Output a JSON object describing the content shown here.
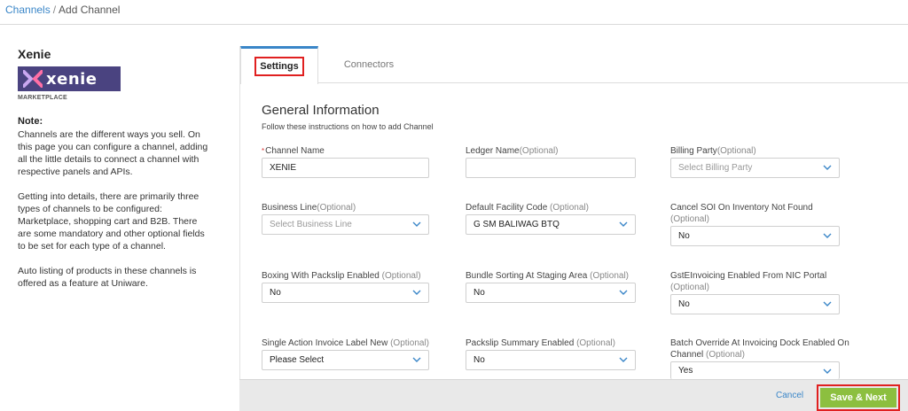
{
  "breadcrumb": {
    "link": "Channels",
    "separator": "/",
    "current": "Add Channel"
  },
  "channel": {
    "name": "Xenie",
    "logo_text": "xenie",
    "type": "MARKETPLACE",
    "note_title": "Note:",
    "note_p1": "Channels are the different ways you sell. On this page you can configure a channel, adding all the little details to connect a channel with respective panels and APIs.",
    "note_p2": "Getting into details, there are primarily three types of channels to be configured: Marketplace, shopping cart and B2B. There are some mandatory and other optional fields to be set for each type of a channel.",
    "note_p3": "Auto listing of products in these channels is offered as a feature at Uniware."
  },
  "tabs": {
    "settings": "Settings",
    "connectors": "Connectors"
  },
  "section": {
    "title": "General Information",
    "subtitle": "Follow these instructions on how to add Channel"
  },
  "fields": {
    "channel_name": {
      "required": "*",
      "label": "Channel Name",
      "value": "XENIE"
    },
    "ledger_name": {
      "label": "Ledger Name",
      "optional": "(Optional)",
      "value": ""
    },
    "billing_party": {
      "label": "Billing Party",
      "optional": "(Optional)",
      "placeholder": "Select Billing Party"
    },
    "business_line": {
      "label": "Business Line",
      "optional": "(Optional)",
      "placeholder": "Select Business Line"
    },
    "default_facility": {
      "label": "Default Facility Code ",
      "optional": "(Optional)",
      "value": "G SM BALIWAG BTQ"
    },
    "cancel_soi": {
      "label": "Cancel SOI On Inventory Not Found",
      "optional": "(Optional)",
      "value": "No"
    },
    "boxing_packslip": {
      "label": "Boxing With Packslip Enabled ",
      "optional": "(Optional)",
      "value": "No"
    },
    "bundle_sorting": {
      "label": "Bundle Sorting At Staging Area ",
      "optional": "(Optional)",
      "value": "No"
    },
    "gst_einvoicing": {
      "label": "GstEInvoicing Enabled From NIC Portal",
      "optional": "(Optional)",
      "value": "No"
    },
    "single_action_invoice": {
      "label": "Single Action Invoice Label New ",
      "optional": "(Optional)",
      "value": "Please Select"
    },
    "packslip_summary": {
      "label": "Packslip Summary Enabled ",
      "optional": "(Optional)",
      "value": "No"
    },
    "batch_override": {
      "label": "Batch Override At Invoicing Dock Enabled On Channel ",
      "optional": "(Optional)",
      "value": "Yes"
    }
  },
  "footer": {
    "cancel": "Cancel",
    "save": "Save & Next"
  },
  "colors": {
    "accent": "#3a86c8",
    "save_green": "#8cbf3f",
    "highlight_red": "#e02020",
    "logo_bg": "#4a4380"
  }
}
